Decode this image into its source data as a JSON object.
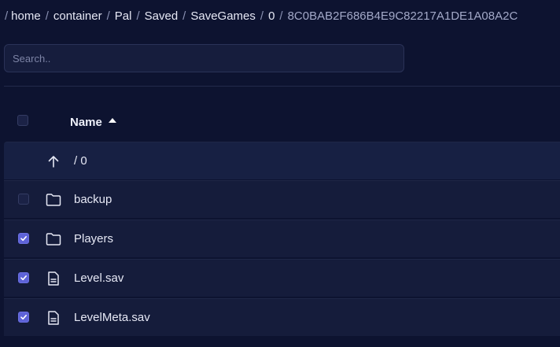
{
  "breadcrumb": {
    "items": [
      "home",
      "container",
      "Pal",
      "Saved",
      "SaveGames",
      "0"
    ],
    "current": "8C0BAB2F686B4E9C82217A1DE1A08A2C"
  },
  "search": {
    "placeholder": "Search..",
    "value": ""
  },
  "table": {
    "header": {
      "name_label": "Name",
      "sort": "ascending"
    },
    "parent_row": {
      "label": "/ 0",
      "icon": "arrow-up-icon"
    },
    "rows": [
      {
        "label": "backup",
        "type": "folder",
        "icon": "folder-icon",
        "checked": false
      },
      {
        "label": "Players",
        "type": "folder",
        "icon": "folder-icon",
        "checked": true
      },
      {
        "label": "Level.sav",
        "type": "file",
        "icon": "file-icon",
        "checked": true
      },
      {
        "label": "LevelMeta.sav",
        "type": "file",
        "icon": "file-icon",
        "checked": true
      }
    ]
  },
  "colors": {
    "background": "#0d1330",
    "row": "#151c3b",
    "checkbox_checked": "#5e63d8",
    "text": "#e6e8f5"
  }
}
